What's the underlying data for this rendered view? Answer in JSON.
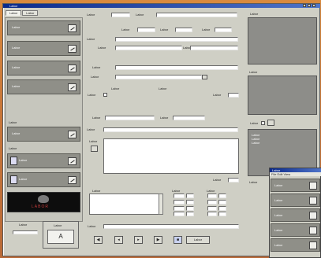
{
  "window": {
    "title": "Labor"
  },
  "tabs": [
    "Labor",
    "Labor"
  ],
  "sidebar": {
    "cards": [
      {
        "line1": "Labor",
        "line2": "Labor"
      },
      {
        "line1": "Labor",
        "line2": "Labor"
      },
      {
        "line1": "Labor",
        "line2": "Labor"
      },
      {
        "line1": "Labor",
        "line2": "Labor"
      }
    ],
    "group2_label": "Labor",
    "group2_cards": [
      {
        "line1": "Labor",
        "line2": "Labor"
      }
    ],
    "group3_label": "Labor",
    "group3_cards": [
      {
        "line1": "Labor"
      },
      {
        "line1": "Labor"
      }
    ]
  },
  "logo": {
    "text": "LABOR"
  },
  "bottom_left": {
    "label1": "Labor",
    "label2": "Labor",
    "value2": "A"
  },
  "form": {
    "r1_lbl": "Labor",
    "r1_val": "",
    "r1_lbl2": "Labor",
    "r2_lbl": "Labor",
    "r2_val": "",
    "r2_lbl2": "Labor",
    "r2_val2": "",
    "r2_lbl3": "Labor",
    "r2_val3": "",
    "r3_lbl": "Labor",
    "r3_val": "",
    "r4_lbl": "Labor",
    "r4_val": "",
    "r4_lbl2": "Labor",
    "r4_val2": "",
    "r5_lbl": "Labor",
    "r5_val": "",
    "r6_lbl": "Labor",
    "r6_val": "",
    "mid_head1": "Labor",
    "mid_head2": "Labor",
    "mid_lbl": "Labor",
    "mid_lbl2": "Labor",
    "r7_lbl": "Labor",
    "r7_val": "",
    "r7_lbl2": "Labor",
    "r7_val2": "",
    "r8_lbl": "Labor",
    "r8_val": "",
    "notes_lbl": "Labor",
    "notes_text": "",
    "notes_foot": "Labor",
    "list_lbl": "Labor",
    "list_col2": "Labor",
    "list_col3": "Labor",
    "bottom_lbl": "Labor",
    "bottom_val": "",
    "action_label": "Labor"
  },
  "right": {
    "head1": "Labor",
    "head2": "Labor",
    "chk_lbl": "Labor",
    "list_lines": [
      "Labor",
      "Labor",
      "Labor"
    ],
    "head3": "Labor"
  },
  "overlay": {
    "title": "Labor",
    "menu": "File  Edit  View",
    "cards": [
      "Labor",
      "Labor",
      "Labor",
      "Labor",
      "Labor"
    ]
  }
}
